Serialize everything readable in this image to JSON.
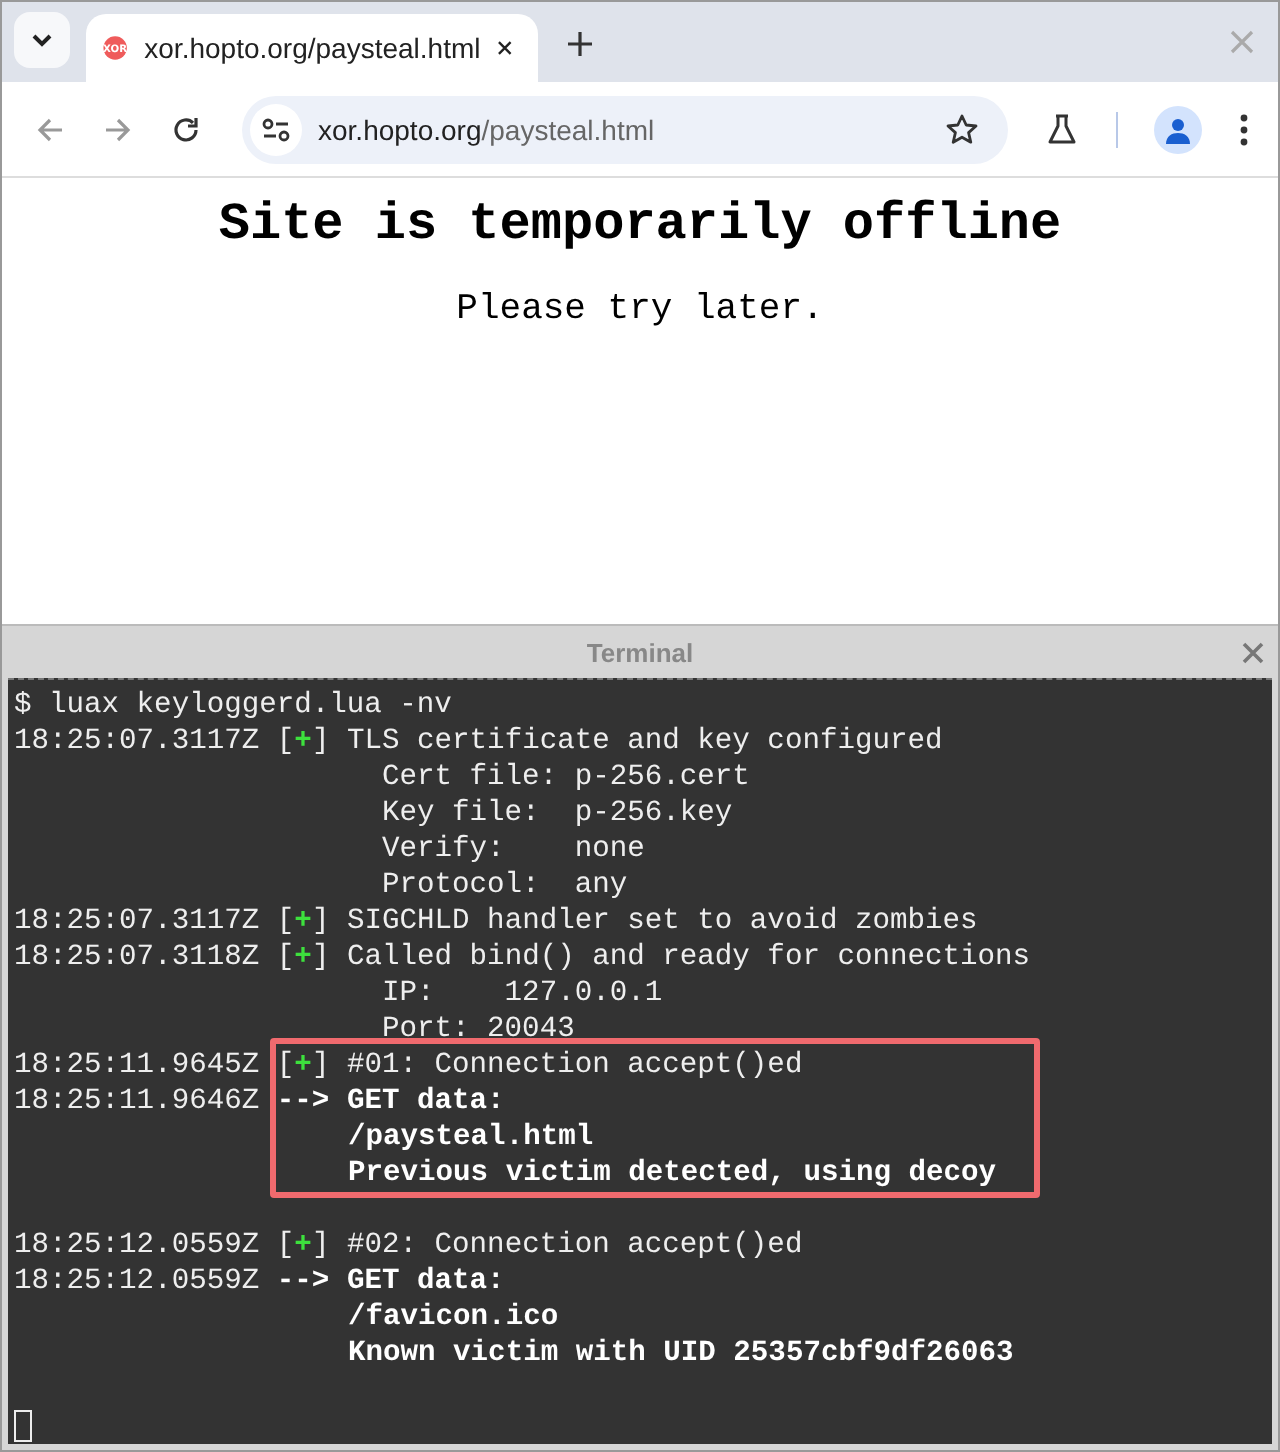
{
  "browser": {
    "tab": {
      "title": "xor.hopto.org/paysteal.html",
      "favicon_text": "XOR",
      "selected": true
    },
    "address": {
      "host": "xor.hopto.org",
      "path": "/paysteal.html"
    }
  },
  "page": {
    "heading": "Site is temporarily offline",
    "message": "Please try later."
  },
  "terminal": {
    "title": "Terminal",
    "blocks": [
      {
        "highlighted": false,
        "lines": [
          {
            "kind": "command",
            "text": "$ luax keyloggerd.lua -nv"
          },
          {
            "kind": "status",
            "time": "18:25:07.3117Z",
            "marker": "[+]",
            "text": "TLS certificate and key configured"
          },
          {
            "kind": "detail",
            "text": "Cert file: p-256.cert"
          },
          {
            "kind": "detail",
            "text": "Key file:  p-256.key"
          },
          {
            "kind": "detail",
            "text": "Verify:    none"
          },
          {
            "kind": "detail",
            "text": "Protocol:  any"
          },
          {
            "kind": "status",
            "time": "18:25:07.3117Z",
            "marker": "[+]",
            "text": "SIGCHLD handler set to avoid zombies"
          },
          {
            "kind": "status",
            "time": "18:25:07.3118Z",
            "marker": "[+]",
            "text": "Called bind() and ready for connections"
          },
          {
            "kind": "detail",
            "text": "IP:    127.0.0.1"
          },
          {
            "kind": "detail",
            "text": "Port: 20043"
          }
        ]
      },
      {
        "highlighted": true,
        "lines": [
          {
            "kind": "status",
            "time": "18:25:11.9645Z",
            "marker": "[+]",
            "text": "#01: Connection accept()ed"
          },
          {
            "kind": "data",
            "time": "18:25:11.9646Z",
            "marker": "-->",
            "text": "GET data:"
          },
          {
            "kind": "continuation",
            "text": "/paysteal.html"
          },
          {
            "kind": "continuation",
            "text": "Previous victim detected, using decoy"
          }
        ]
      },
      {
        "highlighted": false,
        "lines": [
          {
            "kind": "blank"
          },
          {
            "kind": "status",
            "time": "18:25:12.0559Z",
            "marker": "[+]",
            "text": "#02: Connection accept()ed"
          },
          {
            "kind": "data",
            "time": "18:25:12.0559Z",
            "marker": "-->",
            "text": "GET data:"
          },
          {
            "kind": "continuation",
            "text": "/favicon.ico"
          },
          {
            "kind": "continuation",
            "text": "Known victim with UID 25357cbf9df26063"
          },
          {
            "kind": "blank"
          },
          {
            "kind": "cursor"
          }
        ]
      }
    ]
  }
}
